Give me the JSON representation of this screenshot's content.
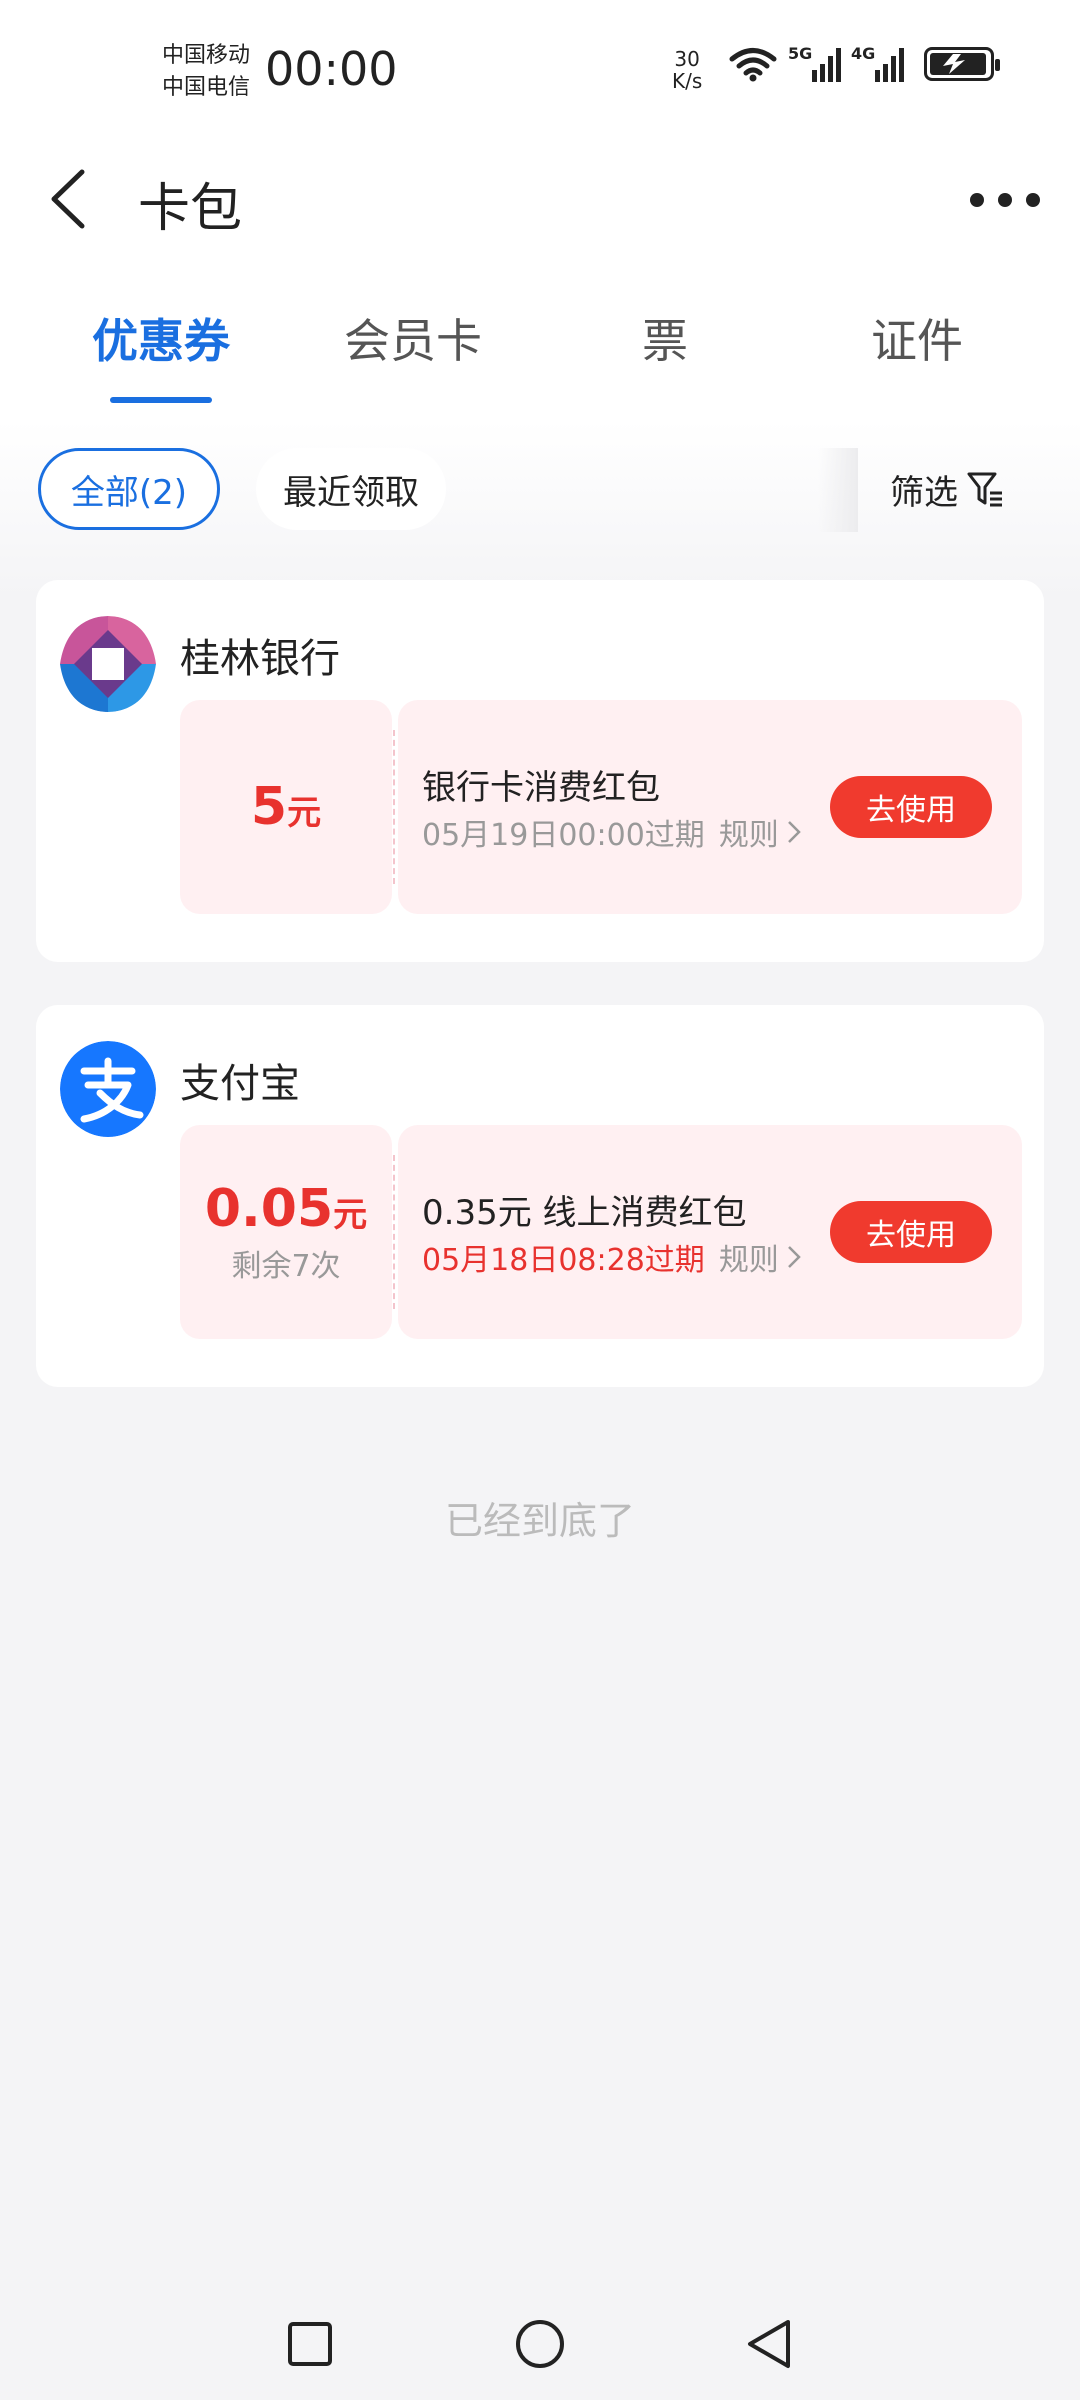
{
  "status_bar": {
    "carrier_1": "中国移动",
    "carrier_2": "中国电信",
    "time": "00:00",
    "speed_value": "30",
    "speed_unit": "K/s",
    "signal_1_label": "5G",
    "signal_2_label": "4G"
  },
  "header": {
    "title": "卡包"
  },
  "tabs": [
    {
      "label": "优惠券",
      "active": true
    },
    {
      "label": "会员卡",
      "active": false
    },
    {
      "label": "票",
      "active": false
    },
    {
      "label": "证件",
      "active": false
    }
  ],
  "filters": {
    "all_label": "全部(2)",
    "recent_label": "最近领取",
    "filter_label": "筛选"
  },
  "coupons": [
    {
      "merchant": "桂林银行",
      "amount": "5",
      "unit": "元",
      "remaining": "",
      "name": "银行卡消费红包",
      "expiry": "05月19日00:00过期",
      "expiry_highlight": false,
      "rule_label": "规则",
      "button_label": "去使用"
    },
    {
      "merchant": "支付宝",
      "amount": "0.05",
      "unit": "元",
      "remaining": "剩余7次",
      "name": "0.35元 线上消费红包",
      "expiry": "05月18日08:28过期",
      "expiry_highlight": true,
      "rule_label": "规则",
      "button_label": "去使用"
    }
  ],
  "footer": {
    "end_text": "已经到底了"
  },
  "colors": {
    "accent": "#1a6fe0",
    "red": "#e8322e",
    "button_red": "#f03a2e"
  }
}
